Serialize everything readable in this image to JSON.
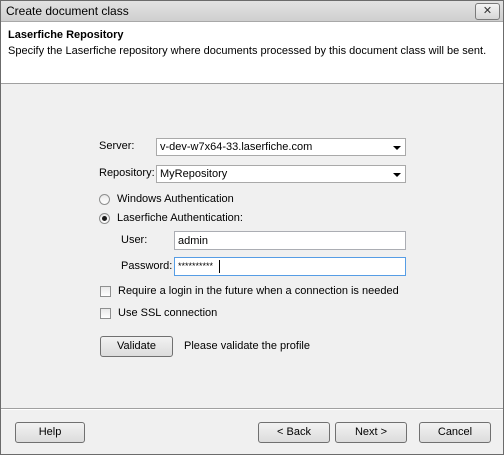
{
  "window": {
    "title": "Create document class",
    "close_glyph": "✕"
  },
  "header": {
    "title": "Laserfiche Repository",
    "description": "Specify the Laserfiche repository where documents processed by this document class will be sent."
  },
  "form": {
    "server_label": "Server:",
    "server_value": "v-dev-w7x64-33.laserfiche.com",
    "repository_label": "Repository:",
    "repository_value": "MyRepository",
    "auth_windows_label": "Windows Authentication",
    "auth_laserfiche_label": "Laserfiche Authentication:",
    "selected_auth": "laserfiche",
    "user_label": "User:",
    "user_value": "admin",
    "password_label": "Password:",
    "password_value": "**********",
    "require_login_label": "Require a login in the future when a connection is needed",
    "require_login_checked": false,
    "ssl_label": "Use SSL connection",
    "ssl_checked": false,
    "validate_button": "Validate",
    "validate_status": "Please validate the profile"
  },
  "footer": {
    "help_button": "Help",
    "back_button": "< Back",
    "next_button": "Next >",
    "cancel_button": "Cancel"
  },
  "icons": {
    "close": "close-icon",
    "dropdown": "chevron-down-icon"
  }
}
